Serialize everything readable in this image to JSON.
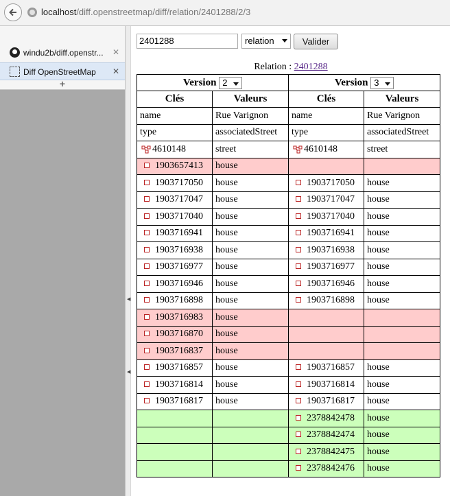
{
  "url": {
    "host": "localhost",
    "path": "/diff.openstreetmap/diff/relation/2401288/2/3"
  },
  "sidebar": {
    "tabs": [
      {
        "label": "windu2b/diff.openstr...",
        "icon": "github-icon"
      },
      {
        "label": "Diff OpenStreetMap",
        "icon": "dotted-box-icon"
      }
    ],
    "new_tab": "+"
  },
  "form": {
    "id_value": "2401288",
    "type_value": "relation",
    "submit_label": "Valider"
  },
  "relation": {
    "label": "Relation : ",
    "id": "2401288"
  },
  "table": {
    "version_label": "Version",
    "left_version": "2",
    "right_version": "3",
    "col_keys": "Clés",
    "col_values": "Valeurs",
    "tags": [
      {
        "key": "name",
        "value": "Rue Varignon"
      },
      {
        "key": "type",
        "value": "associatedStreet"
      }
    ],
    "rows": [
      {
        "state": "same",
        "type": "relation",
        "left_id": "4610148",
        "left_role": "street",
        "right_id": "4610148",
        "right_role": "street"
      },
      {
        "state": "removed",
        "type": "node",
        "left_id": "1903657413",
        "left_role": "house",
        "right_id": "",
        "right_role": ""
      },
      {
        "state": "same",
        "type": "node",
        "left_id": "1903717050",
        "left_role": "house",
        "right_id": "1903717050",
        "right_role": "house"
      },
      {
        "state": "same",
        "type": "node",
        "left_id": "1903717047",
        "left_role": "house",
        "right_id": "1903717047",
        "right_role": "house"
      },
      {
        "state": "same",
        "type": "node",
        "left_id": "1903717040",
        "left_role": "house",
        "right_id": "1903717040",
        "right_role": "house"
      },
      {
        "state": "same",
        "type": "node",
        "left_id": "1903716941",
        "left_role": "house",
        "right_id": "1903716941",
        "right_role": "house"
      },
      {
        "state": "same",
        "type": "node",
        "left_id": "1903716938",
        "left_role": "house",
        "right_id": "1903716938",
        "right_role": "house"
      },
      {
        "state": "same",
        "type": "node",
        "left_id": "1903716977",
        "left_role": "house",
        "right_id": "1903716977",
        "right_role": "house"
      },
      {
        "state": "same",
        "type": "node",
        "left_id": "1903716946",
        "left_role": "house",
        "right_id": "1903716946",
        "right_role": "house"
      },
      {
        "state": "same",
        "type": "node",
        "left_id": "1903716898",
        "left_role": "house",
        "right_id": "1903716898",
        "right_role": "house"
      },
      {
        "state": "removed",
        "type": "node",
        "left_id": "1903716983",
        "left_role": "house",
        "right_id": "",
        "right_role": ""
      },
      {
        "state": "removed",
        "type": "node",
        "left_id": "1903716870",
        "left_role": "house",
        "right_id": "",
        "right_role": ""
      },
      {
        "state": "removed",
        "type": "node",
        "left_id": "1903716837",
        "left_role": "house",
        "right_id": "",
        "right_role": ""
      },
      {
        "state": "same",
        "type": "node",
        "left_id": "1903716857",
        "left_role": "house",
        "right_id": "1903716857",
        "right_role": "house"
      },
      {
        "state": "same",
        "type": "node",
        "left_id": "1903716814",
        "left_role": "house",
        "right_id": "1903716814",
        "right_role": "house"
      },
      {
        "state": "same",
        "type": "node",
        "left_id": "1903716817",
        "left_role": "house",
        "right_id": "1903716817",
        "right_role": "house"
      },
      {
        "state": "added",
        "type": "node",
        "left_id": "",
        "left_role": "",
        "right_id": "2378842478",
        "right_role": "house"
      },
      {
        "state": "added",
        "type": "node",
        "left_id": "",
        "left_role": "",
        "right_id": "2378842474",
        "right_role": "house"
      },
      {
        "state": "added",
        "type": "node",
        "left_id": "",
        "left_role": "",
        "right_id": "2378842475",
        "right_role": "house"
      },
      {
        "state": "added",
        "type": "node",
        "left_id": "",
        "left_role": "",
        "right_id": "2378842476",
        "right_role": "house"
      }
    ]
  },
  "colors": {
    "removed": "#ffcccc",
    "added": "#ccffbb"
  }
}
